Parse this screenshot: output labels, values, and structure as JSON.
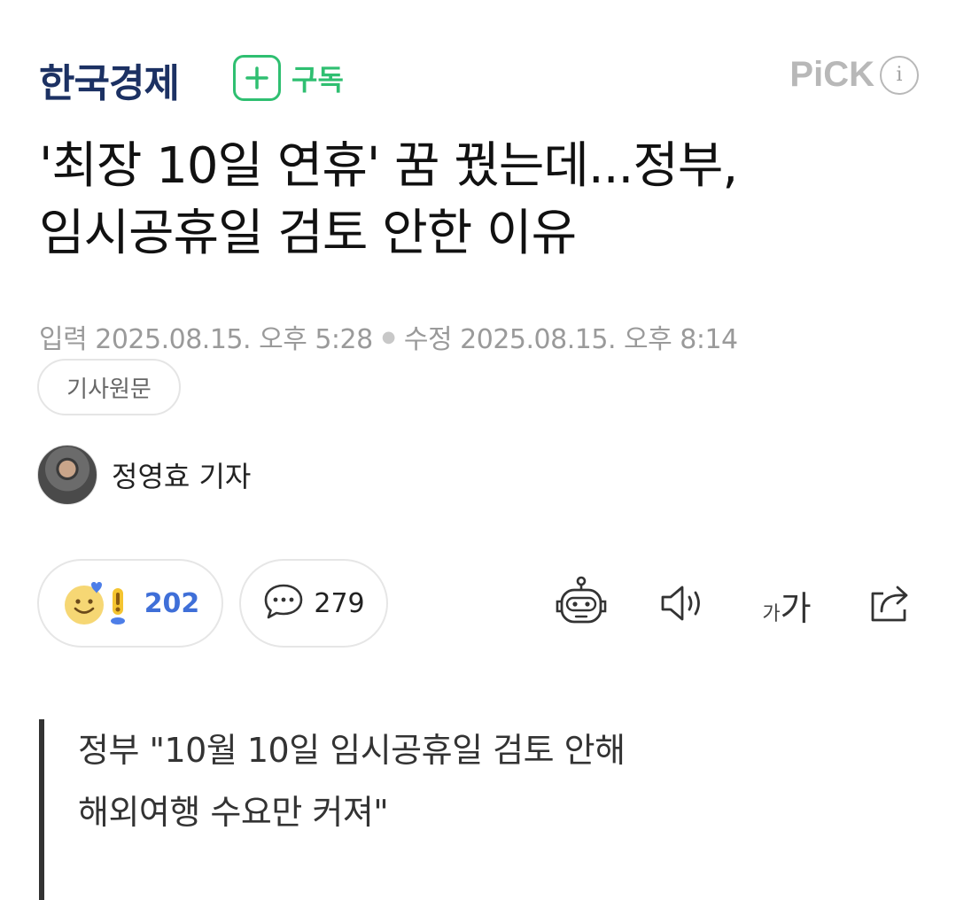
{
  "header": {
    "press_name": "한국경제",
    "subscribe_label": "구독",
    "pick_label": "PiCK",
    "info_icon": "i"
  },
  "article": {
    "title_line1": "'최장 10일 연휴' 꿈 꿨는데...정부,",
    "title_line2": "임시공휴일 검토 안한 이유",
    "input_label": "입력",
    "input_date": "2025.08.15. 오후 5:28",
    "modified_label": "수정",
    "modified_date": "2025.08.15. 오후 8:14",
    "original_button": "기사원문",
    "author": "정영효 기자",
    "subtitle_line1": "정부 \"10월 10일 임시공휴일 검토 안해",
    "subtitle_line2": "해외여행 수요만 커져\""
  },
  "actions": {
    "reaction_count": "202",
    "comment_count": "279",
    "font_small": "가",
    "font_big": "가"
  },
  "colors": {
    "press": "#1c3163",
    "subscribe": "#2fbf71",
    "reaction_count": "#3f6fd8"
  },
  "icons": {
    "subscribe": "plus-icon",
    "info": "info-icon",
    "reaction": "smile-reaction-icon",
    "comment": "speech-bubble-icon",
    "summary": "robot-icon",
    "tts": "speaker-icon",
    "font_size": "font-size-icon",
    "share": "share-icon"
  }
}
